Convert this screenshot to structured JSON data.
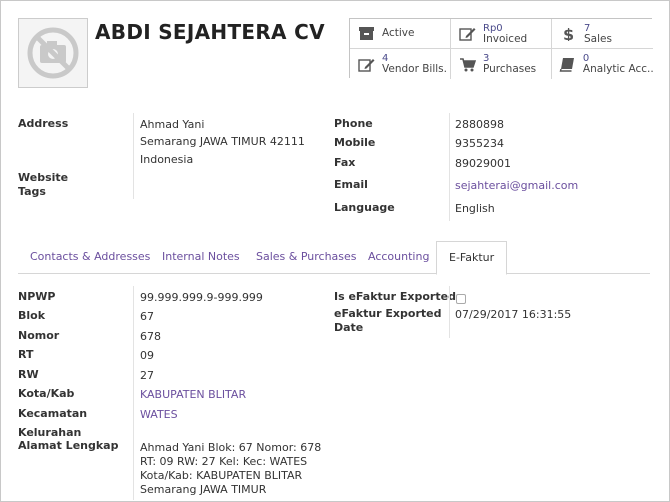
{
  "partner": {
    "name": "ABDI SEJAHTERA CV"
  },
  "stat_buttons": [
    {
      "icon": "archive-icon",
      "single": "Active"
    },
    {
      "icon": "edit-icon",
      "value": "Rp0",
      "label": "Invoiced"
    },
    {
      "icon": "dollar-icon",
      "value": "7",
      "label": "Sales"
    },
    {
      "icon": "edit-icon",
      "value": "4",
      "label": "Vendor Bills."
    },
    {
      "icon": "cart-icon",
      "value": "3",
      "label": "Purchases"
    },
    {
      "icon": "book-icon",
      "value": "0",
      "label": "Analytic Acc..."
    }
  ],
  "address": {
    "label": "Address",
    "line1": "Ahmad Yani",
    "line2": "Semarang JAWA TIMUR 42111",
    "line3": "Indonesia",
    "website_label": "Website",
    "tags_label": "Tags"
  },
  "contact": {
    "phone_label": "Phone",
    "phone": "2880898",
    "mobile_label": "Mobile",
    "mobile": "9355234",
    "fax_label": "Fax",
    "fax": "89029001",
    "email_label": "Email",
    "email": "sejahterai@gmail.com",
    "language_label": "Language",
    "language": "English"
  },
  "tabs": [
    "Contacts & Addresses",
    "Internal Notes",
    "Sales & Purchases",
    "Accounting",
    "E-Faktur"
  ],
  "efaktur": {
    "npwp_label": "NPWP",
    "npwp": "99.999.999.9-999.999",
    "blok_label": "Blok",
    "blok": "67",
    "nomor_label": "Nomor",
    "nomor": "678",
    "rt_label": "RT",
    "rt": "09",
    "rw_label": "RW",
    "rw": "27",
    "kota_label": "Kota/Kab",
    "kota": "KABUPATEN BLITAR",
    "kecamatan_label": "Kecamatan",
    "kecamatan": "WATES",
    "kelurahan_label": "Kelurahan",
    "alamat_label": "Alamat Lengkap",
    "alamat_line1": "Ahmad Yani Blok: 67 Nomor: 678",
    "alamat_line2": "RT: 09 RW: 27 Kel: Kec: WATES",
    "alamat_line3": "Kota/Kab: KABUPATEN BLITAR",
    "alamat_line4": "Semarang JAWA TIMUR",
    "exported_label": "Is eFaktur Exported",
    "exported_date_label1": "eFaktur Exported",
    "exported_date_label2": "Date",
    "exported_date": "07/29/2017 16:31:55"
  },
  "colors": {
    "link": "#6b4f9e",
    "border": "#d6d6d6"
  }
}
